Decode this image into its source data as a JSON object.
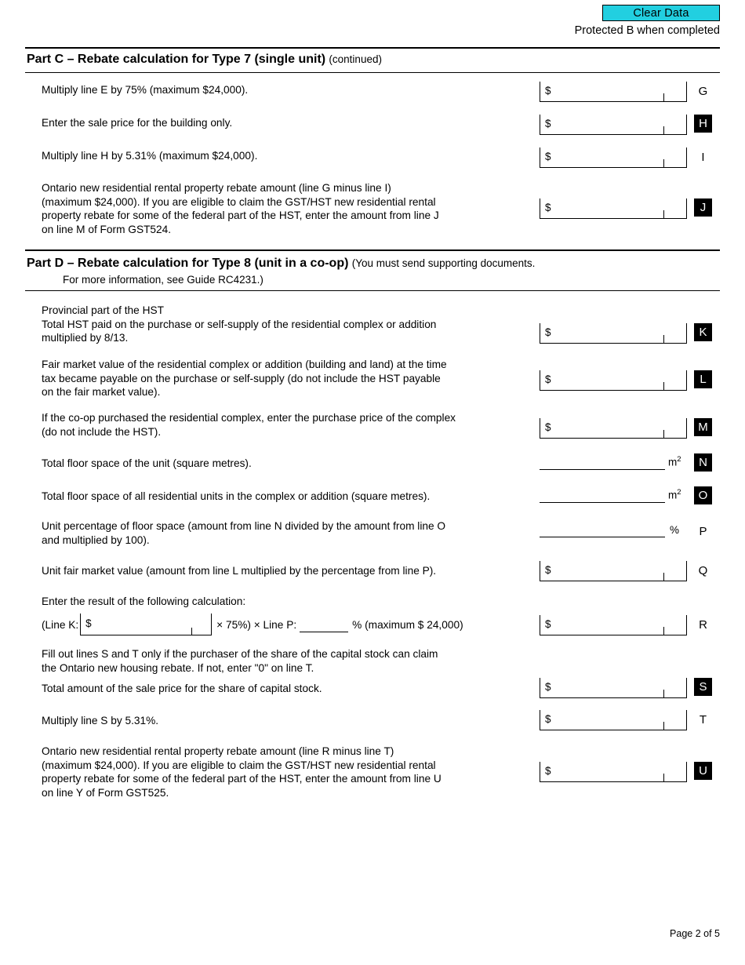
{
  "header": {
    "clear_data_label": "Clear Data",
    "clear_data_color": "#22CFE0",
    "protected_text": "Protected B when completed"
  },
  "part_c": {
    "heading_bold": "Part C – Rebate calculation for Type 7 (single unit)",
    "heading_note": "(continued)",
    "rows": [
      {
        "text": "Multiply line E  by 75% (maximum $24,000).",
        "letter": "G",
        "boxed": false,
        "field": "money",
        "value": ""
      },
      {
        "text": "Enter the sale price for the building only.",
        "letter": "H",
        "boxed": true,
        "field": "money",
        "value": ""
      },
      {
        "text": "Multiply line H by 5.31% (maximum $24,000).",
        "letter": "I",
        "boxed": false,
        "field": "money",
        "value": ""
      },
      {
        "text": "Ontario new residential rental property rebate amount (line G minus line I)\n(maximum $24,000). If you are eligible to claim the GST/HST new residential rental\nproperty rebate for some of the federal part of the HST, enter the amount from line J\non line M of Form GST524.",
        "letter": "J",
        "boxed": true,
        "field": "money",
        "value": ""
      }
    ]
  },
  "part_d": {
    "heading_bold": "Part D – Rebate calculation for Type 8 (unit in a co-op)",
    "heading_note": "(You must send supporting documents.",
    "heading_sub": "For more information, see Guide RC4231.)",
    "rows": [
      {
        "text": "Provincial part of the HST\nTotal HST paid on the purchase or self-supply of the residential complex or addition\nmultiplied by 8/13.",
        "letter": "K",
        "boxed": true,
        "field": "money",
        "value": ""
      },
      {
        "text": "Fair market value of the residential complex or addition (building and land) at the time\ntax became payable on the purchase or self-supply (do not include the HST payable\non the fair market value).",
        "letter": "L",
        "boxed": true,
        "field": "money",
        "value": ""
      },
      {
        "text": "If the co-op purchased the residential complex, enter the purchase price of the complex\n(do not include the HST).",
        "letter": "M",
        "boxed": true,
        "field": "money",
        "value": ""
      },
      {
        "text": "Total floor space of the unit (square metres).",
        "letter": "N",
        "boxed": true,
        "field": "underline",
        "unit": "m2",
        "value": ""
      },
      {
        "text": "Total floor space of all residential units in the complex or addition (square metres).",
        "letter": "O",
        "boxed": true,
        "field": "underline",
        "unit": "m2",
        "value": ""
      },
      {
        "text": "Unit percentage of floor space (amount from line N divided by the amount from line O\nand multiplied by 100).",
        "letter": "P",
        "boxed": false,
        "field": "underline",
        "unit": "%",
        "value": ""
      },
      {
        "text": "Unit fair market value (amount from line L multiplied by the percentage from line P).",
        "letter": "Q",
        "boxed": false,
        "field": "money",
        "value": ""
      }
    ],
    "calc_intro": "Enter the result of the following calculation:",
    "calc": {
      "prefix": "(Line K:",
      "line_k_value": "",
      "middle": "×  75%)   ×  Line P:",
      "line_p_value": "",
      "suffix": "% (maximum $ 24,000)",
      "letter": "R",
      "boxed": false,
      "value": ""
    },
    "note_st": "Fill out lines S and T only if the purchaser of the share of the capital stock can claim\nthe Ontario new housing rebate. If not, enter \"0\" on line T.",
    "rows_end": [
      {
        "text": "Total amount of the sale price for the share of capital stock.",
        "letter": "S",
        "boxed": true,
        "field": "money",
        "value": ""
      },
      {
        "text": "Multiply line S by 5.31%.",
        "letter": "T",
        "boxed": false,
        "field": "money",
        "value": ""
      },
      {
        "text": "Ontario new residential rental property rebate amount (line R minus line T)\n(maximum $24,000). If you are eligible to claim the GST/HST new residential rental\nproperty rebate for some of the federal part of the HST, enter the amount from line U\non line Y of Form GST525.",
        "letter": "U",
        "boxed": true,
        "field": "money",
        "value": ""
      }
    ]
  },
  "footer": {
    "page_label": "Page 2 of 5"
  }
}
